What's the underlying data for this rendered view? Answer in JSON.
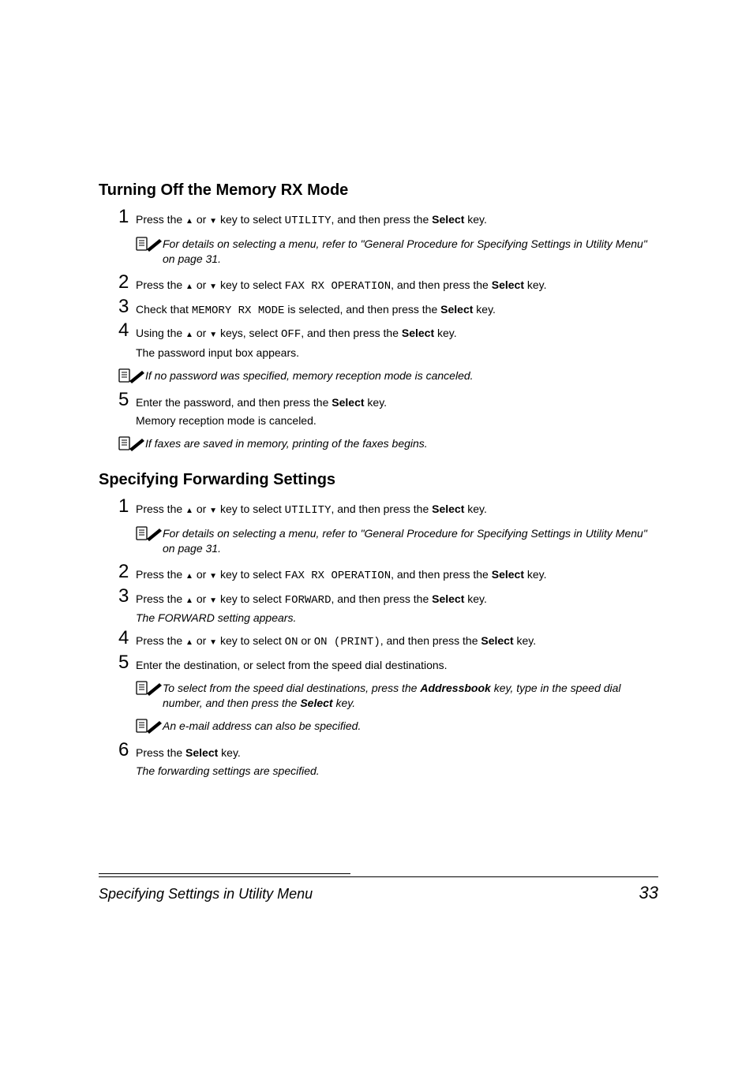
{
  "section1": {
    "title": "Turning Off the Memory RX Mode",
    "step1": {
      "pre": "Press the ",
      "mid": " or ",
      "post1": " key to select ",
      "code": "UTILITY",
      "post2": ", and then press the ",
      "bold": "Select",
      "post3": " key."
    },
    "note1": "For details on selecting a menu, refer to \"General Procedure for Specifying Settings in Utility Menu\" on page 31.",
    "step2": {
      "pre": "Press the ",
      "mid": " or ",
      "post1": " key to select ",
      "code": "FAX RX OPERATION",
      "post2": ", and then press the ",
      "bold": "Select",
      "post3": " key."
    },
    "step3": {
      "pre": "Check that ",
      "code": "MEMORY RX MODE",
      "post1": " is selected, and then press the ",
      "bold": "Select",
      "post2": " key."
    },
    "step4": {
      "pre": "Using the ",
      "mid": " or ",
      "post1": " keys, select ",
      "code": "OFF",
      "post2": ", and then press the ",
      "bold": "Select",
      "post3": " key."
    },
    "step4_sub": "The password input box appears.",
    "note2": "If no password was specified, memory reception mode is canceled.",
    "step5": {
      "pre": "Enter the password, and then press the ",
      "bold": "Select",
      "post": " key."
    },
    "step5_sub": "Memory reception mode is canceled.",
    "note3": "If faxes are saved in memory, printing of the faxes begins."
  },
  "section2": {
    "title": "Specifying Forwarding Settings",
    "step1": {
      "pre": "Press the ",
      "mid": " or ",
      "post1": " key to select ",
      "code": "UTILITY",
      "post2": ", and then press the ",
      "bold": "Select",
      "post3": " key."
    },
    "note1": "For details on selecting a menu, refer to \"General Procedure for Specifying Settings in Utility Menu\" on page 31.",
    "step2": {
      "pre": "Press the ",
      "mid": " or ",
      "post1": " key to select ",
      "code": "FAX RX OPERATION",
      "post2": ", and then press the ",
      "bold": "Select",
      "post3": " key."
    },
    "step3": {
      "pre": "Press the ",
      "mid": " or ",
      "post1": " key to select ",
      "code": "FORWARD",
      "post2": ", and then press the ",
      "bold": "Select",
      "post3": " key."
    },
    "step3_sub": "The FORWARD setting appears.",
    "step4": {
      "pre": "Press the ",
      "mid": " or ",
      "post1": " key to select ",
      "code1": "ON",
      "or": " or ",
      "code2": "ON (PRINT)",
      "post2": ", and then press the ",
      "bold": "Select",
      "post3": " key."
    },
    "step5": "Enter the destination, or select from the speed dial destinations.",
    "note2a": "To select from the speed dial destinations, press the ",
    "note2b": "Address­book",
    "note2c": " key, type in the speed dial number, and then press the ",
    "note2d": "Select",
    "note2e": " key.",
    "note3": "An e-mail address can also be specified.",
    "step6": {
      "pre": "Press the ",
      "bold": "Select",
      "post": " key."
    },
    "step6_sub": "The forwarding settings are specified."
  },
  "footer": {
    "title": "Specifying Settings in Utility Menu",
    "page": "33"
  }
}
